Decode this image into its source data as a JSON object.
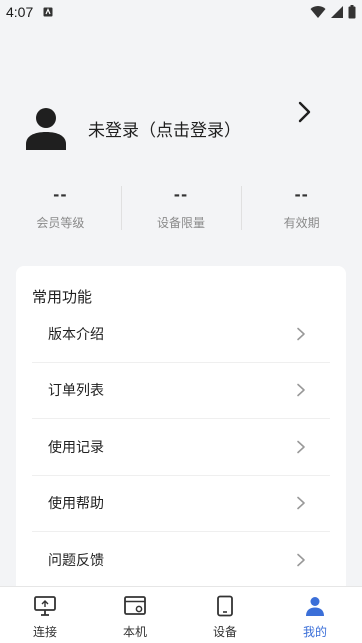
{
  "status_bar": {
    "time": "4:07"
  },
  "profile": {
    "login_text": "未登录（点击登录）"
  },
  "stats": [
    {
      "value": "--",
      "label": "会员等级"
    },
    {
      "value": "--",
      "label": "设备限量"
    },
    {
      "value": "--",
      "label": "有效期"
    }
  ],
  "functions": {
    "title": "常用功能",
    "items": [
      {
        "label": "版本介绍"
      },
      {
        "label": "订单列表"
      },
      {
        "label": "使用记录"
      },
      {
        "label": "使用帮助"
      },
      {
        "label": "问题反馈"
      }
    ]
  },
  "bottom_nav": {
    "items": [
      {
        "label": "连接",
        "icon": "monitor-icon"
      },
      {
        "label": "本机",
        "icon": "window-gear-icon"
      },
      {
        "label": "设备",
        "icon": "device-icon"
      },
      {
        "label": "我的",
        "icon": "person-icon"
      }
    ],
    "active_color": "#3b6fd8"
  }
}
